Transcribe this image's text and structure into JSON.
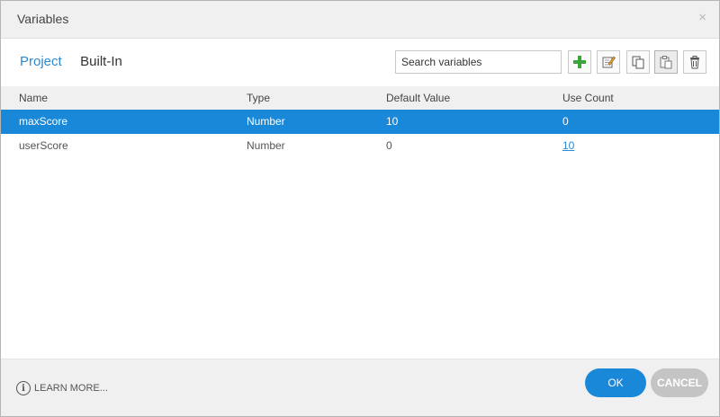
{
  "dialog": {
    "title": "Variables",
    "close_glyph": "×"
  },
  "tabs": [
    {
      "label": "Project",
      "active": true
    },
    {
      "label": "Built-In",
      "active": false
    }
  ],
  "search": {
    "placeholder": "Search variables",
    "value": ""
  },
  "toolbar": {
    "buttons": [
      {
        "icon": "add-icon",
        "color": "#3aa53a"
      },
      {
        "icon": "edit-icon"
      },
      {
        "icon": "copy-icon"
      },
      {
        "icon": "paste-icon"
      },
      {
        "icon": "delete-icon"
      }
    ]
  },
  "table": {
    "columns": [
      "Name",
      "Type",
      "Default Value",
      "Use Count"
    ],
    "rows": [
      {
        "name": "maxScore",
        "type": "Number",
        "default": "10",
        "use_count": "0",
        "selected": true
      },
      {
        "name": "userScore",
        "type": "Number",
        "default": "0",
        "use_count": "10",
        "selected": false
      }
    ]
  },
  "footer": {
    "learn_more": "LEARN MORE...",
    "ok_label": "OK",
    "cancel_label": "CANCEL"
  },
  "colors": {
    "accent": "#1a88d8",
    "link": "#2a8ad4",
    "cancel_bg": "#c4c4c4"
  }
}
